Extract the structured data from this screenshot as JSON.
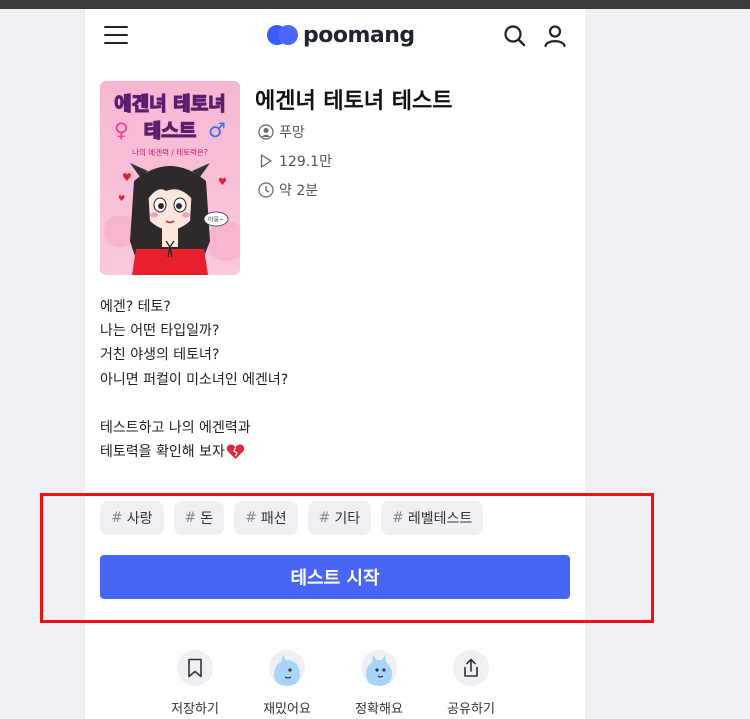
{
  "header": {
    "logo_text": "poomang"
  },
  "test": {
    "title": "에겐녀 테토녀 테스트",
    "author": "푸망",
    "plays": "129.1만",
    "duration": "약 2분",
    "thumbnail": {
      "title_line1": "에겐녀 테토녀",
      "title_line2": "테스트",
      "subtitle": "나의 에겐력 / 테토력은?",
      "bubble": "아웅~"
    }
  },
  "description": [
    "에겐? 테토?",
    "나는 어떤 타입일까?",
    "거친 야생의 테토녀?",
    "아니면 퍼컬이 미소녀인 에겐녀?",
    "",
    "테스트하고 나의 에겐력과",
    "테토력을 확인해 보자"
  ],
  "tags": [
    {
      "hash": "#",
      "label": "사랑"
    },
    {
      "hash": "#",
      "label": "돈"
    },
    {
      "hash": "#",
      "label": "패션"
    },
    {
      "hash": "#",
      "label": "기타"
    },
    {
      "hash": "#",
      "label": "레벨테스트"
    }
  ],
  "start_button": "테스트 시작",
  "actions": [
    {
      "label": "저장하기",
      "icon": "bookmark-icon"
    },
    {
      "label": "재밌어요",
      "icon": "fun-reaction-icon"
    },
    {
      "label": "정확해요",
      "icon": "accurate-reaction-icon"
    },
    {
      "label": "공유하기",
      "icon": "share-icon"
    }
  ],
  "colors": {
    "accent": "#4766f6",
    "highlight": "#f01010",
    "tag_bg": "#eef0f3"
  }
}
